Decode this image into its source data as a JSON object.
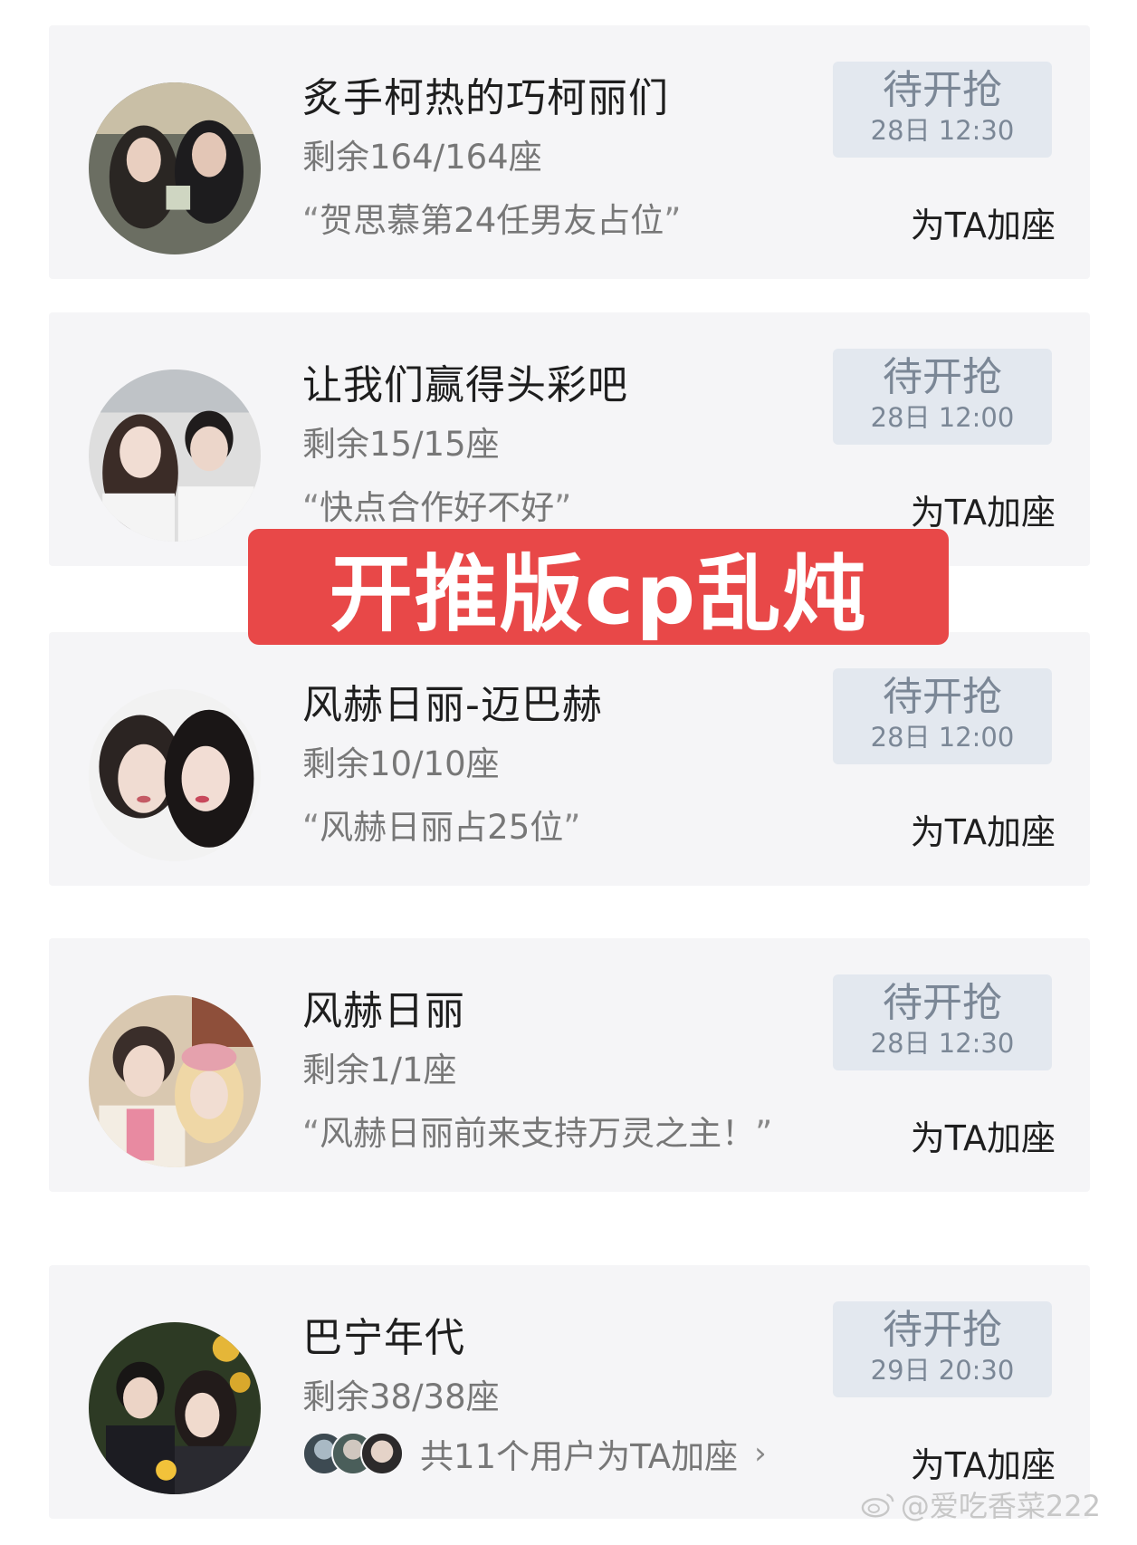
{
  "banner": {
    "text": "开推版cp乱炖"
  },
  "watermark": {
    "text": "@爱吃香菜222",
    "icon": "weibo-icon"
  },
  "cards": [
    {
      "title": "炙手柯热的巧柯丽们",
      "seats": "剩余164/164座",
      "quote": "贺思慕第24任男友占位",
      "button_label": "待开抢",
      "button_time": "28日 12:30",
      "action": "为TA加座"
    },
    {
      "title": "让我们赢得头彩吧",
      "seats": "剩余15/15座",
      "quote": "快点合作好不好",
      "button_label": "待开抢",
      "button_time": "28日 12:00",
      "action": "为TA加座"
    },
    {
      "title": "风赫日丽-迈巴赫",
      "seats": "剩余10/10座",
      "quote": "风赫日丽占25位",
      "button_label": "待开抢",
      "button_time": "28日 12:00",
      "action": "为TA加座"
    },
    {
      "title": "风赫日丽",
      "seats": "剩余1/1座",
      "quote": "风赫日丽前来支持万灵之主！",
      "button_label": "待开抢",
      "button_time": "28日 12:30",
      "action": "为TA加座"
    },
    {
      "title": "巴宁年代",
      "seats": "剩余38/38座",
      "users_text": "共11个用户为TA加座",
      "button_label": "待开抢",
      "button_time": "29日 20:30",
      "action": "为TA加座"
    }
  ],
  "colors": {
    "banner": "#e84848",
    "card_bg": "#f5f5f7",
    "button_bg": "#e3e8ef",
    "button_text": "#7b8796"
  }
}
